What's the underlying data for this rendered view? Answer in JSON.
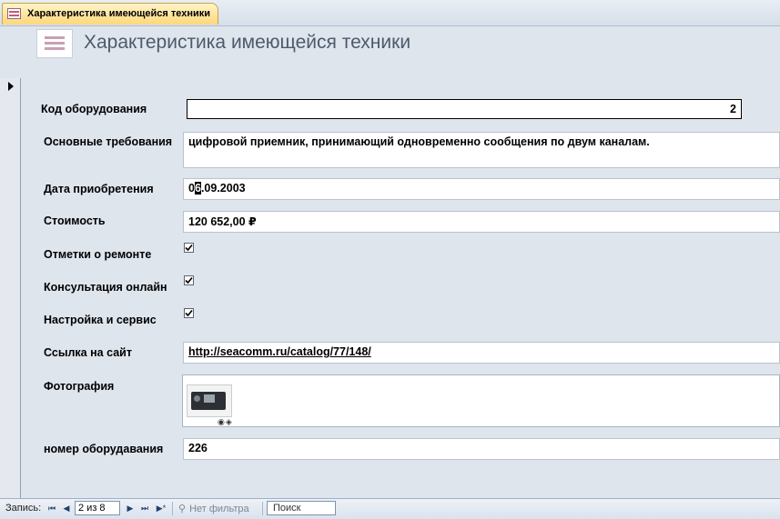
{
  "tab": {
    "title": "Характеристика имеющейся техники",
    "icon": "form-icon"
  },
  "header": {
    "title": "Характеристика имеющейся техники",
    "icon": "form-icon"
  },
  "fields": {
    "equipment_code": {
      "label": "Код оборудования",
      "value": "2"
    },
    "requirements": {
      "label": "Основные требования",
      "value": "цифровой приемник, принимающий одновременно сообщения по двум каналам."
    },
    "purchase_date": {
      "label": "Дата приобретения",
      "value_before": "0",
      "value_cursor": "6",
      "value_after": ".09.2003"
    },
    "cost": {
      "label": "Стоимость",
      "value": "120 652,00 ₽"
    },
    "repair_marks": {
      "label": "Отметки о ремонте",
      "checked": true
    },
    "online_consult": {
      "label": "Консультация онлайн",
      "checked": true
    },
    "setup_service": {
      "label": "Настройка и сервис",
      "checked": true
    },
    "site_link": {
      "label": "Ссылка на сайт",
      "value": "http://seacomm.ru/catalog/77/148/"
    },
    "photo": {
      "label": "Фотография"
    },
    "equipment_number": {
      "label": "номер оборудавания",
      "value": "226"
    }
  },
  "navbar": {
    "record_label": "Запись:",
    "first": "⏮",
    "prev": "◀",
    "next": "▶",
    "last": "⏭",
    "new": "▶*",
    "position": "2 из 8",
    "filter_label": "Нет фильтра",
    "search_label": "Поиск"
  }
}
